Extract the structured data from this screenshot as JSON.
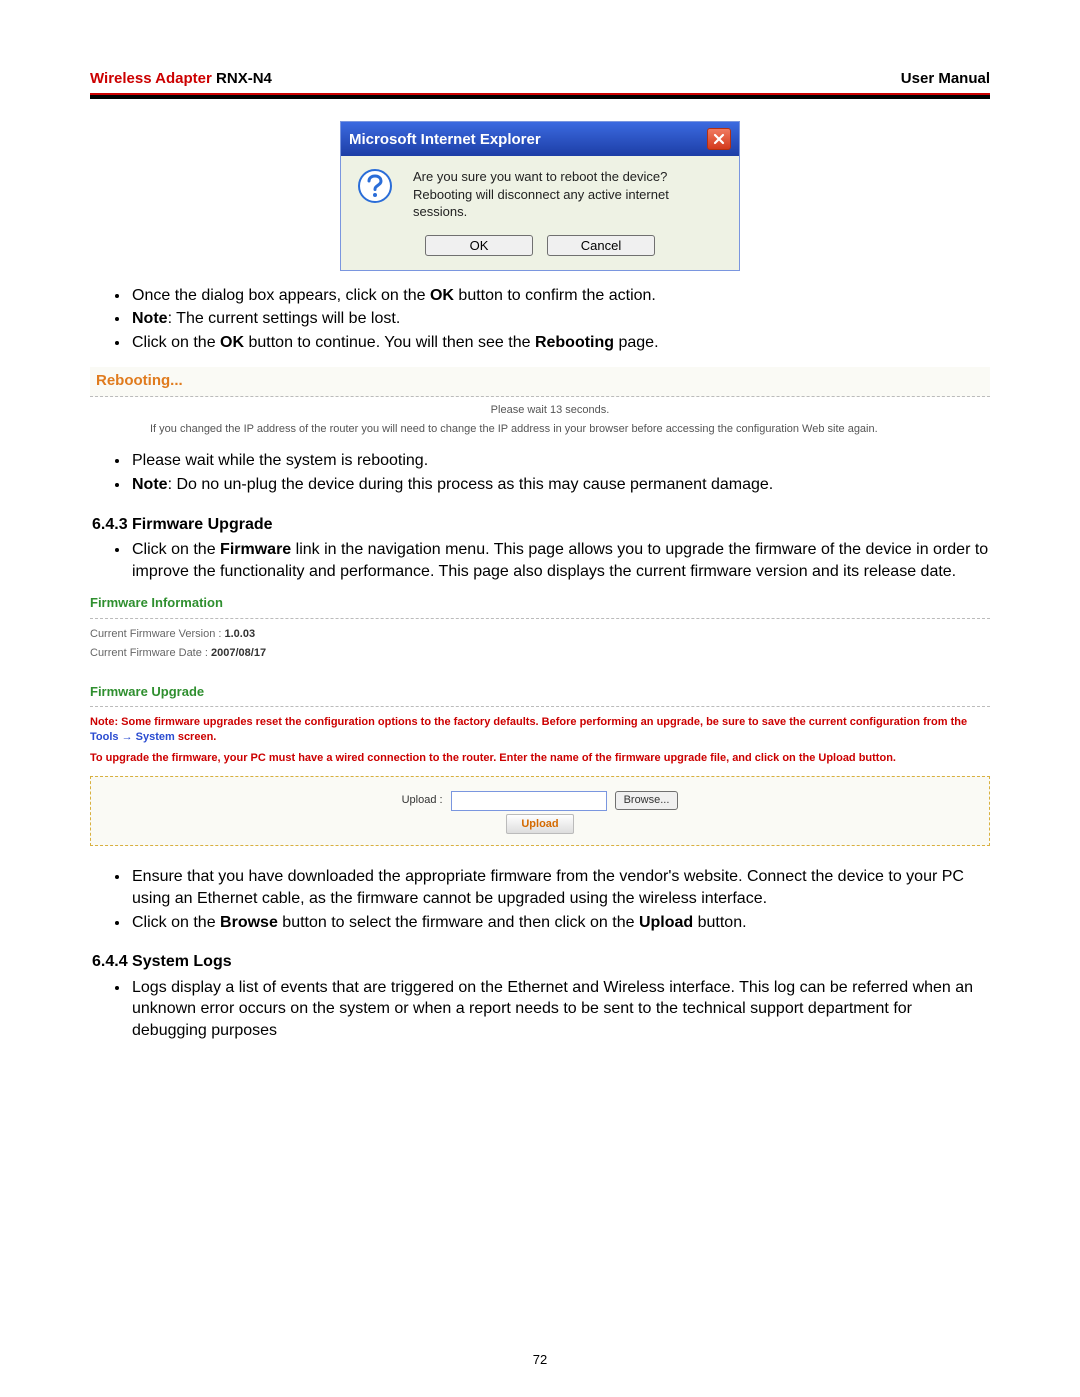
{
  "header": {
    "product": "Wireless Adapter",
    "model": "RNX-N4",
    "right": "User Manual"
  },
  "ie": {
    "title": "Microsoft Internet Explorer",
    "msg1": "Are you sure you want to reboot the device?",
    "msg2": "Rebooting will disconnect any active internet sessions.",
    "ok": "OK",
    "cancel": "Cancel"
  },
  "list1": {
    "a_pre": "Once the dialog box appears, click on the ",
    "a_b": "OK",
    "a_post": " button to confirm the action.",
    "b_b": "Note",
    "b_post": ": The current settings will be lost.",
    "c_pre": "Click on the ",
    "c_b1": "OK",
    "c_mid": " button to continue.  You will then see the ",
    "c_b2": "Rebooting",
    "c_post": " page."
  },
  "reboot": {
    "title": "Rebooting...",
    "wait": "Please wait 13 seconds.",
    "msg": "If you changed the IP address of the router you will need to change the IP address in your browser before accessing the configuration Web site again."
  },
  "list2": {
    "a": "Please wait while the system is rebooting.",
    "b_b": "Note",
    "b_post": ": Do no un-plug the device during this process as this may cause permanent damage."
  },
  "sect643": {
    "h": "6.4.3  Firmware Upgrade",
    "a_pre": "Click on the ",
    "a_b": "Firmware",
    "a_post": " link in the navigation menu. This page allows you to upgrade the firmware of the device in order to improve the functionality and performance. This page also displays the current firmware version and its release date."
  },
  "fw": {
    "h1": "Firmware Information",
    "ver_lbl": "Current Firmware Version : ",
    "ver_val": "1.0.03",
    "date_lbl": "Current Firmware Date : ",
    "date_val": "2007/08/17",
    "h2": "Firmware Upgrade",
    "n1a": "Note: Some firmware upgrades reset the configuration options to the factory defaults. Before performing an upgrade, be sure to save the current configuration from the ",
    "n1b": "Tools → System",
    "n1c": " screen.",
    "n2": "To upgrade the firmware, your PC must have a wired connection to the router. Enter the name of the firmware upgrade file, and click on the Upload button.",
    "up_lbl": "Upload :",
    "browse": "Browse...",
    "upload": "Upload"
  },
  "list3": {
    "a": "Ensure that you have downloaded the appropriate firmware from the vendor's website. Connect the device to your PC using an Ethernet cable, as the firmware cannot be upgraded using the wireless interface.",
    "b_pre": "Click on the ",
    "b_b1": "Browse",
    "b_mid": " button to select the firmware and then click on the ",
    "b_b2": "Upload",
    "b_post": " button."
  },
  "sect644": {
    "h": "6.4.4  System Logs",
    "a": "Logs display a list of events that are triggered on the Ethernet and Wireless interface. This log can be referred when an unknown error occurs on the system or when a report needs to be sent to the technical support department for debugging purposes"
  },
  "page_num": "72"
}
